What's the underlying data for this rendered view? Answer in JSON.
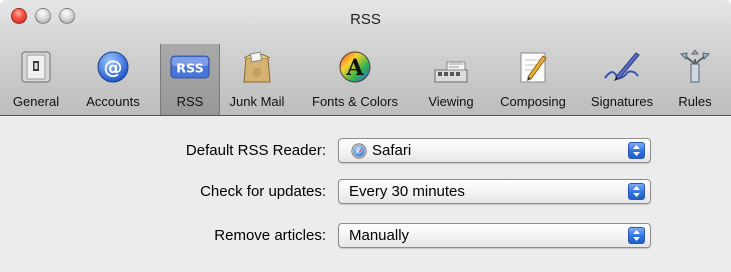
{
  "window": {
    "title": "RSS"
  },
  "toolbar": {
    "items": [
      {
        "label": "General",
        "icon": "general-icon"
      },
      {
        "label": "Accounts",
        "icon": "accounts-icon"
      },
      {
        "label": "RSS",
        "icon": "rss-icon",
        "selected": true
      },
      {
        "label": "Junk Mail",
        "icon": "junk-mail-icon"
      },
      {
        "label": "Fonts & Colors",
        "icon": "fonts-colors-icon"
      },
      {
        "label": "Viewing",
        "icon": "viewing-icon"
      },
      {
        "label": "Composing",
        "icon": "composing-icon"
      },
      {
        "label": "Signatures",
        "icon": "signatures-icon"
      },
      {
        "label": "Rules",
        "icon": "rules-icon"
      }
    ]
  },
  "settings": {
    "default_reader": {
      "label": "Default RSS Reader:",
      "value": "Safari",
      "icon": "safari-icon"
    },
    "check_updates": {
      "label": "Check for updates:",
      "value": "Every 30 minutes"
    },
    "remove_articles": {
      "label": "Remove articles:",
      "value": "Manually"
    }
  },
  "colors": {
    "close": "#ff5a4e",
    "selected_tab": "#9f9f9f",
    "popup_arrow": "#2f72e0",
    "rss_badge": "#4a74d6"
  },
  "icons": {
    "rss_text": "RSS",
    "accounts_glyph": "@",
    "fonts_glyph": "A"
  }
}
